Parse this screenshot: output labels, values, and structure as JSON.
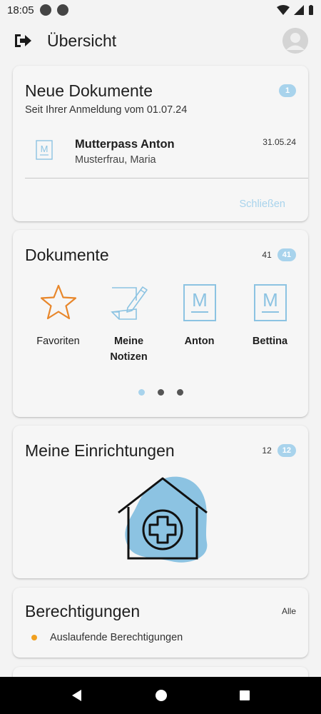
{
  "status_bar": {
    "time": "18:05"
  },
  "app_bar": {
    "title": "Übersicht",
    "logout_icon": "logout-arrow-icon",
    "avatar_icon": "user-avatar-icon"
  },
  "new_documents": {
    "title": "Neue Dokumente",
    "badge": "1",
    "subtitle": "Seit Ihrer Anmeldung vom 01.07.24",
    "item": {
      "icon": "document-m-icon",
      "title": "Mutterpass Anton",
      "subtitle": "Musterfrau, Maria",
      "date": "31.05.24"
    },
    "close_label": "Schließen"
  },
  "documents": {
    "title": "Dokumente",
    "count": "41",
    "badge": "41",
    "tiles": [
      {
        "label": "Favoriten",
        "icon": "star-icon"
      },
      {
        "label": "Meine Notizen",
        "icon": "note-edit-icon"
      },
      {
        "label": "Anton",
        "icon": "document-m-icon"
      },
      {
        "label": "Bettina",
        "icon": "document-m-icon"
      }
    ],
    "pager": {
      "pages": 3,
      "active": 1
    }
  },
  "institutions": {
    "title": "Meine Einrichtungen",
    "count": "12",
    "badge": "12",
    "illustration": "medical-house-icon"
  },
  "permissions": {
    "title": "Berechtigungen",
    "all_label": "Alle",
    "item_label": "Auslaufende Berechtigungen"
  },
  "colors": {
    "accent": "#a8d3ec",
    "warning": "#f1a020",
    "star": "#e8872b"
  }
}
